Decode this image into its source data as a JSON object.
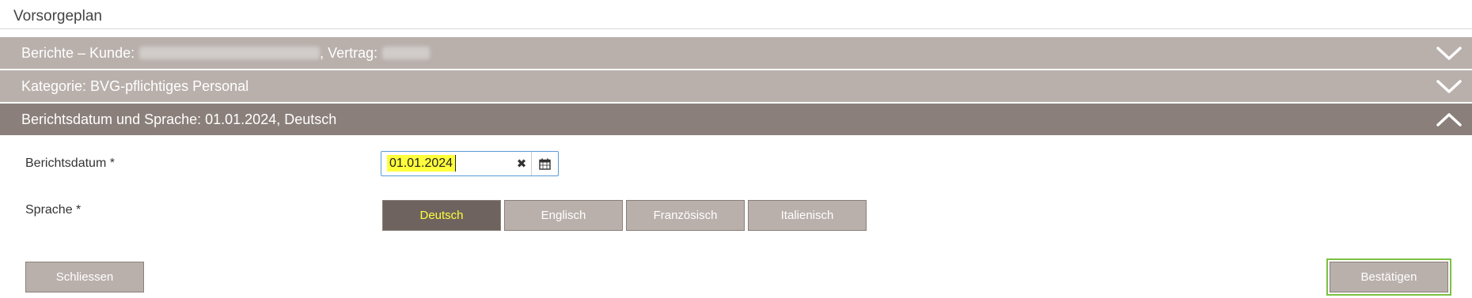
{
  "page": {
    "title": "Vorsorgeplan"
  },
  "accordion": {
    "reports": {
      "prefix": "Berichte – Kunde:",
      "contract_prefix": ", Vertrag:"
    },
    "category": {
      "label": "Kategorie: BVG-pflichtiges Personal"
    },
    "date_language": {
      "label": "Berichtsdatum und Sprache: 01.01.2024, Deutsch"
    }
  },
  "form": {
    "date_label": "Berichtsdatum *",
    "date_value": "01.01.2024",
    "language_label": "Sprache *",
    "languages": [
      "Deutsch",
      "Englisch",
      "Französisch",
      "Italienisch"
    ],
    "selected_language": "Deutsch"
  },
  "actions": {
    "close_label": "Schliessen",
    "confirm_label": "Bestätigen"
  },
  "colors": {
    "header_collapsed": "#b9b0ac",
    "header_expanded": "#8a7f7a",
    "selected_button": "#6e635f",
    "highlight": "#ffff3c",
    "focus_outline": "#7bc142"
  },
  "icons": {
    "expand": "chevron-down-icon",
    "collapse": "chevron-up-icon",
    "clear": "clear-icon",
    "calendar": "calendar-icon"
  }
}
